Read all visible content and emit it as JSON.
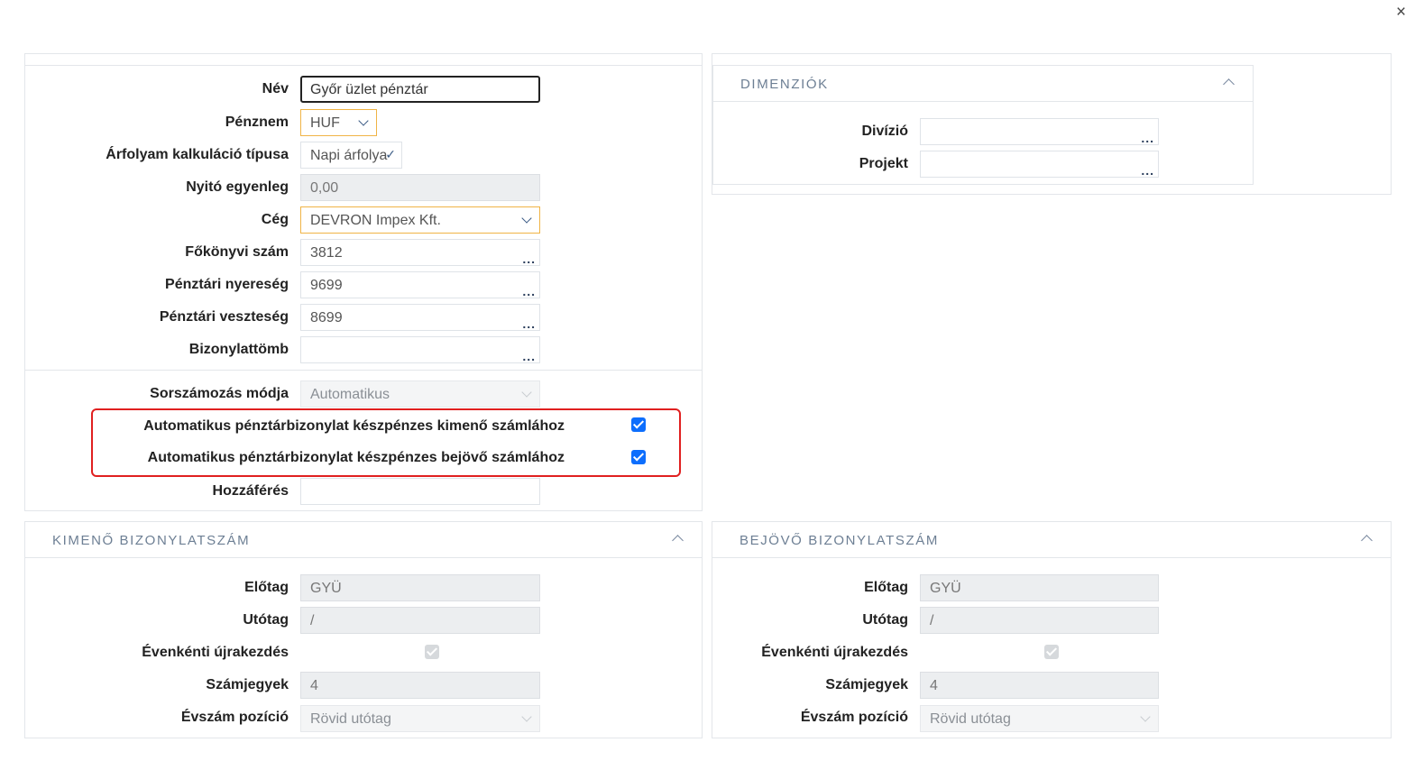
{
  "window": {
    "close_icon": "×"
  },
  "main_form": {
    "fields": {
      "nev": {
        "label": "Név",
        "value": "Győr üzlet pénztár"
      },
      "penznem": {
        "label": "Pénznem",
        "value": "HUF"
      },
      "arfolyam": {
        "label": "Árfolyam kalkuláció típusa",
        "value": "Napi árfolya"
      },
      "nyito": {
        "label": "Nyitó egyenleg",
        "value": "0,00"
      },
      "ceg": {
        "label": "Cég",
        "value": "DEVRON Impex Kft."
      },
      "fokonyvi": {
        "label": "Főkönyvi szám",
        "value": "3812"
      },
      "nyereseg": {
        "label": "Pénztári nyereség",
        "value": "9699"
      },
      "veszteseg": {
        "label": "Pénztári veszteség",
        "value": "8699"
      },
      "bizonylattomb": {
        "label": "Bizonylattömb",
        "value": ""
      },
      "sorszamozas": {
        "label": "Sorszámozás módja",
        "value": "Automatikus"
      },
      "auto_kimeno": {
        "label": "Automatikus pénztárbizonylat készpénzes kimenő számlához",
        "checked": true
      },
      "auto_bejovo": {
        "label": "Automatikus pénztárbizonylat készpénzes bejövő számlához",
        "checked": true
      },
      "hozzaferes": {
        "label": "Hozzáférés",
        "value": ""
      }
    },
    "lookup_dots": "..."
  },
  "dimenziok": {
    "title": "DIMENZIÓK",
    "divizio": {
      "label": "Divízió",
      "value": ""
    },
    "projekt": {
      "label": "Projekt",
      "value": ""
    }
  },
  "kimeno": {
    "title": "KIMENŐ BIZONYLATSZÁM",
    "elotag": {
      "label": "Előtag",
      "value": "GYÜ"
    },
    "utotag": {
      "label": "Utótag",
      "value": "/"
    },
    "evenkenti": {
      "label": "Évenkénti újrakezdés",
      "checked": true
    },
    "szamjegyek": {
      "label": "Számjegyek",
      "value": "4"
    },
    "evszam": {
      "label": "Évszám pozíció",
      "value": "Rövid utótag"
    }
  },
  "bejovo": {
    "title": "BEJÖVŐ BIZONYLATSZÁM",
    "elotag": {
      "label": "Előtag",
      "value": "GYÜ"
    },
    "utotag": {
      "label": "Utótag",
      "value": "/"
    },
    "evenkenti": {
      "label": "Évenkénti újrakezdés",
      "checked": true
    },
    "szamjegyek": {
      "label": "Számjegyek",
      "value": "4"
    },
    "evszam": {
      "label": "Évszám pozíció",
      "value": "Rövid utótag"
    }
  },
  "colors": {
    "accent": "#0d6efd",
    "highlight_border": "#e02020",
    "select_border": "#f0b446",
    "section_title": "#6d7f94"
  }
}
